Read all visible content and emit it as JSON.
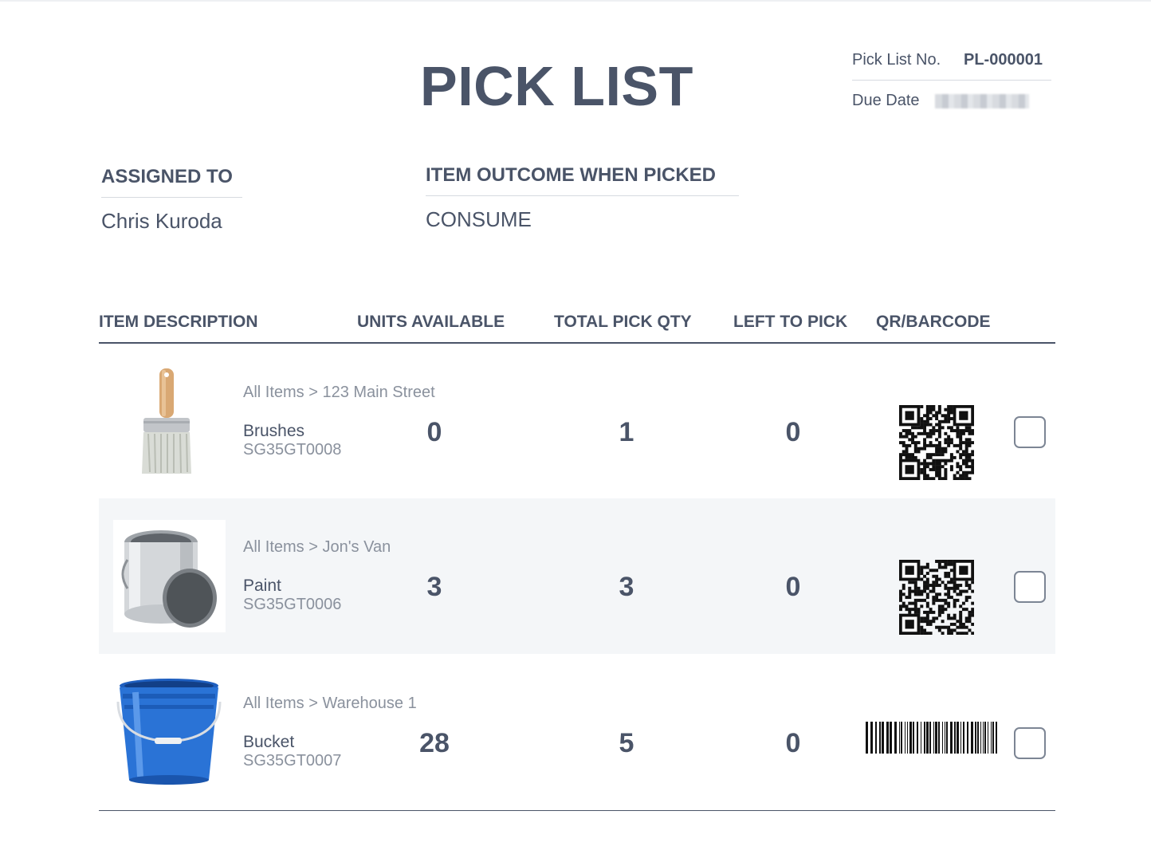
{
  "document": {
    "title": "PICK LIST",
    "pick_list_no_label": "Pick List No.",
    "pick_list_no": "PL-000001",
    "due_date_label": "Due Date"
  },
  "assigned": {
    "label": "ASSIGNED TO",
    "value": "Chris Kuroda"
  },
  "outcome": {
    "label": "ITEM OUTCOME WHEN PICKED",
    "value": "CONSUME"
  },
  "table": {
    "headers": [
      "ITEM DESCRIPTION",
      "UNITS AVAILABLE",
      "TOTAL PICK QTY",
      "LEFT TO PICK",
      "QR/BARCODE"
    ],
    "rows": [
      {
        "path": "All Items > 123 Main Street",
        "name": "Brushes",
        "sku": "SG35GT0008",
        "units_available": "0",
        "total_pick_qty": "1",
        "left_to_pick": "0",
        "code_type": "qr-code",
        "image": "paint-brush"
      },
      {
        "path": "All Items > Jon's Van",
        "name": "Paint",
        "sku": "SG35GT0006",
        "units_available": "3",
        "total_pick_qty": "3",
        "left_to_pick": "0",
        "code_type": "qr-code",
        "image": "paint-can"
      },
      {
        "path": "All Items > Warehouse 1",
        "name": "Bucket",
        "sku": "SG35GT0007",
        "units_available": "28",
        "total_pick_qty": "5",
        "left_to_pick": "0",
        "code_type": "barcode",
        "image": "blue-bucket"
      }
    ]
  },
  "colors": {
    "text": "#4a5468",
    "muted": "#8a919d",
    "alt_row": "#f4f6f8",
    "rule": "#d6dae0"
  }
}
